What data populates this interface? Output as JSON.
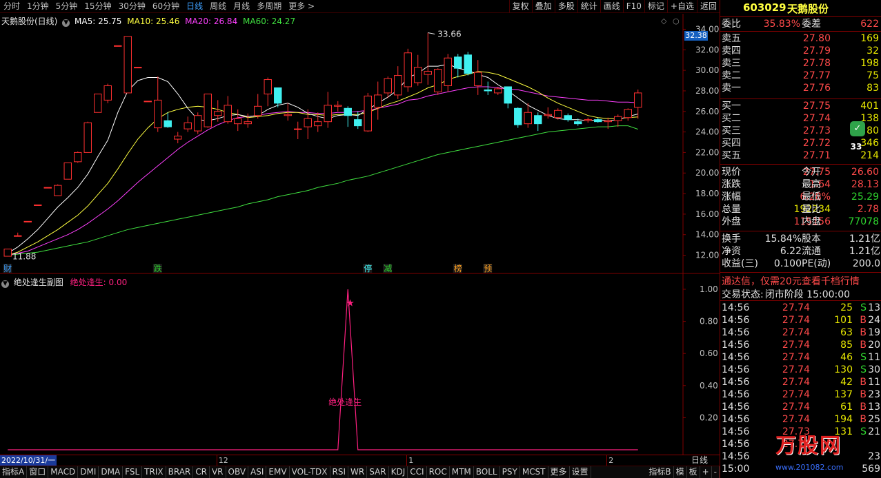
{
  "toolbar": {
    "periods": [
      "分时",
      "1分钟",
      "5分钟",
      "15分钟",
      "30分钟",
      "60分钟",
      "日线",
      "周线",
      "月线",
      "多周期",
      "更多 >"
    ],
    "active_period": "日线",
    "buttons": [
      "复权",
      "叠加",
      "多股",
      "统计",
      "画线",
      "F10",
      "标记",
      "+自选",
      "返回"
    ]
  },
  "main_legend": {
    "title": "天鹅股份(日线)",
    "ma5": "MA5: 25.75",
    "ma10": "MA10: 25.46",
    "ma20": "MA20: 26.84",
    "ma60": "MA60: 24.27"
  },
  "colors": {
    "up": "#ff3030",
    "down": "#40f0f0",
    "ma5": "#ffffff",
    "ma10": "#ffff40",
    "ma20": "#ff40ff",
    "ma60": "#40e040",
    "axis": "#800000",
    "sub": "#ff2080"
  },
  "y_axis": {
    "labels": [
      "34.00",
      "32.00",
      "30.00",
      "28.00",
      "26.00",
      "24.00",
      "22.00",
      "20.00",
      "18.00",
      "16.00",
      "14.00",
      "12.00"
    ],
    "current_price_tag": "32.38"
  },
  "annotations": {
    "high_label": "33.66",
    "low_label": "11.88",
    "markers": [
      {
        "text": "财",
        "color": "#3ea0ff"
      },
      {
        "text": "跌",
        "color": "#2fd62f"
      },
      {
        "text": "停",
        "color": "#40f0f0"
      },
      {
        "text": "减",
        "color": "#2fd62f"
      },
      {
        "text": "榜",
        "color": "#ffa020"
      },
      {
        "text": "预",
        "color": "#ffa020"
      }
    ]
  },
  "sub_chart": {
    "title": "绝处逢生副图",
    "indicator": "绝处逢生: 0.00",
    "y_labels": [
      "1.00",
      "0.80",
      "0.60",
      "0.40",
      "0.20"
    ],
    "peak_label": "绝处逢生"
  },
  "date_axis": {
    "start": "2022/10/31/一",
    "labels": [
      "12",
      "1",
      "2"
    ],
    "right_label": "日线"
  },
  "bottom_tabs": [
    "指标A",
    "窗口",
    "MACD",
    "DMI",
    "DMA",
    "FSL",
    "TRIX",
    "BRAR",
    "CR",
    "VR",
    "OBV",
    "ASI",
    "EMV",
    "VOL-TDX",
    "RSI",
    "WR",
    "SAR",
    "KDJ",
    "CCI",
    "ROC",
    "MTM",
    "BOLL",
    "PSY",
    "MCST",
    "更多",
    "设置"
  ],
  "bottom_right": [
    "指标B",
    "模",
    "板",
    "+",
    "-"
  ],
  "quote": {
    "code": "603029",
    "name": "天鹅股份",
    "weibi_label": "委比",
    "weibi": "35.83%",
    "weicha_label": "委差",
    "weicha": "622",
    "asks": [
      {
        "label": "卖五",
        "price": "27.80",
        "vol": "169"
      },
      {
        "label": "卖四",
        "price": "27.79",
        "vol": "32"
      },
      {
        "label": "卖三",
        "price": "27.78",
        "vol": "198"
      },
      {
        "label": "卖二",
        "price": "27.77",
        "vol": "75"
      },
      {
        "label": "卖一",
        "price": "27.76",
        "vol": "83"
      }
    ],
    "bids": [
      {
        "label": "买一",
        "price": "27.75",
        "vol": "401"
      },
      {
        "label": "买二",
        "price": "27.74",
        "vol": "138"
      },
      {
        "label": "买三",
        "price": "27.73",
        "vol": "80"
      },
      {
        "label": "买四",
        "price": "27.72",
        "vol": "346"
      },
      {
        "label": "买五",
        "price": "27.71",
        "vol": "214"
      }
    ],
    "stats": [
      {
        "l1": "现价",
        "v1": "27.75",
        "l2": "今开",
        "v2": "26.60"
      },
      {
        "l1": "涨跌",
        "v1": "1.64",
        "l2": "最高",
        "v2": "28.13"
      },
      {
        "l1": "涨幅",
        "v1": "6.28%",
        "l2": "最低",
        "v2": "25.29"
      },
      {
        "l1": "总量",
        "v1": "192234",
        "l2": "量比",
        "v2": "2.78"
      },
      {
        "l1": "外盘",
        "v1": "115156",
        "l2": "内盘",
        "v2": "77078"
      }
    ],
    "stats2": [
      {
        "l1": "换手",
        "v1": "15.84%",
        "l2": "股本",
        "v2": "1.21亿"
      },
      {
        "l1": "净资",
        "v1": "6.22",
        "l2": "流通",
        "v2": "1.21亿"
      },
      {
        "l1": "收益(三)",
        "v1": "0.100",
        "l2": "PE(动)",
        "v2": "200.0"
      }
    ],
    "ad": "通达信，仅需20元查看千档行情",
    "status_label": "交易状态:",
    "status": "闭市阶段 15:00:00",
    "ticks": [
      {
        "t": "14:56",
        "p": "27.74",
        "v": "25",
        "d": "S",
        "n": "13"
      },
      {
        "t": "14:56",
        "p": "27.74",
        "v": "101",
        "d": "B",
        "n": "24"
      },
      {
        "t": "14:56",
        "p": "27.74",
        "v": "63",
        "d": "B",
        "n": "19"
      },
      {
        "t": "14:56",
        "p": "27.74",
        "v": "85",
        "d": "B",
        "n": "20"
      },
      {
        "t": "14:56",
        "p": "27.74",
        "v": "46",
        "d": "S",
        "n": "11"
      },
      {
        "t": "14:56",
        "p": "27.74",
        "v": "130",
        "d": "S",
        "n": "30"
      },
      {
        "t": "14:56",
        "p": "27.74",
        "v": "42",
        "d": "B",
        "n": "11"
      },
      {
        "t": "14:56",
        "p": "27.74",
        "v": "137",
        "d": "B",
        "n": "23"
      },
      {
        "t": "14:56",
        "p": "27.74",
        "v": "61",
        "d": "B",
        "n": "13"
      },
      {
        "t": "14:56",
        "p": "27.74",
        "v": "194",
        "d": "B",
        "n": "25"
      },
      {
        "t": "14:56",
        "p": "27.73",
        "v": "131",
        "d": "S",
        "n": "21"
      },
      {
        "t": "14:56",
        "p": "27.74",
        "v": "",
        "d": "",
        "n": ""
      },
      {
        "t": "14:56",
        "p": "",
        "v": "",
        "d": "",
        "n": "23"
      },
      {
        "t": "15:00",
        "p": "",
        "v": "",
        "d": "",
        "n": "569"
      }
    ],
    "side_badge": "33",
    "watermark": "万股网",
    "watermark_url": "www.201082.com"
  },
  "chart_data": {
    "type": "candlestick",
    "ylim": [
      11.5,
      34.5
    ],
    "candles": [
      {
        "o": 11.9,
        "c": 12.6,
        "h": 12.6,
        "l": 11.88
      },
      {
        "o": 13.9,
        "c": 13.9,
        "h": 14.2,
        "l": 13.9
      },
      {
        "o": 15.3,
        "c": 15.3,
        "h": 15.3,
        "l": 15.3
      },
      {
        "o": 16.9,
        "c": 16.9,
        "h": 16.9,
        "l": 16.9
      },
      {
        "o": 18.6,
        "c": 18.6,
        "h": 18.6,
        "l": 18.6
      },
      {
        "o": 17.8,
        "c": 18.8,
        "h": 18.9,
        "l": 17.8
      },
      {
        "o": 19.4,
        "c": 21.0,
        "h": 21.0,
        "l": 19.4
      },
      {
        "o": 21.1,
        "c": 22.0,
        "h": 22.1,
        "l": 21.0
      },
      {
        "o": 22.0,
        "c": 24.9,
        "h": 25.0,
        "l": 22.0
      },
      {
        "o": 25.9,
        "c": 27.7,
        "h": 27.7,
        "l": 25.9
      },
      {
        "o": 27.1,
        "c": 28.5,
        "h": 28.7,
        "l": 26.8
      },
      {
        "o": 32.4,
        "c": 32.4,
        "h": 32.4,
        "l": 32.4
      },
      {
        "o": 27.8,
        "c": 33.3,
        "h": 33.3,
        "l": 27.8
      },
      {
        "o": 30.3,
        "c": 30.3,
        "h": 30.3,
        "l": 30.3
      },
      {
        "o": 27.0,
        "c": 27.0,
        "h": 27.0,
        "l": 27.0
      },
      {
        "o": 24.4,
        "c": 27.1,
        "h": 29.4,
        "l": 24.0
      },
      {
        "o": 25.1,
        "c": 24.5,
        "h": 25.9,
        "l": 24.4
      },
      {
        "o": 23.3,
        "c": 23.6,
        "h": 24.0,
        "l": 22.9
      },
      {
        "o": 24.3,
        "c": 24.9,
        "h": 25.5,
        "l": 24.0
      },
      {
        "o": 24.1,
        "c": 25.6,
        "h": 25.9,
        "l": 23.8
      },
      {
        "o": 24.5,
        "c": 27.7,
        "h": 27.7,
        "l": 24.4
      },
      {
        "o": 25.6,
        "c": 26.0,
        "h": 27.1,
        "l": 25.0
      },
      {
        "o": 25.0,
        "c": 26.6,
        "h": 27.5,
        "l": 24.8
      },
      {
        "o": 24.8,
        "c": 25.3,
        "h": 26.2,
        "l": 24.1
      },
      {
        "o": 24.8,
        "c": 25.0,
        "h": 25.8,
        "l": 24.4
      },
      {
        "o": 25.6,
        "c": 26.5,
        "h": 27.7,
        "l": 25.3
      },
      {
        "o": 27.7,
        "c": 29.1,
        "h": 29.3,
        "l": 26.5
      },
      {
        "o": 28.3,
        "c": 26.8,
        "h": 28.3,
        "l": 26.4
      },
      {
        "o": 25.6,
        "c": 25.7,
        "h": 26.8,
        "l": 25.1
      },
      {
        "o": 24.3,
        "c": 24.3,
        "h": 25.0,
        "l": 23.3
      },
      {
        "o": 24.5,
        "c": 25.3,
        "h": 26.2,
        "l": 23.3
      },
      {
        "o": 24.6,
        "c": 25.0,
        "h": 25.9,
        "l": 24.0
      },
      {
        "o": 25.0,
        "c": 26.6,
        "h": 27.9,
        "l": 24.4
      },
      {
        "o": 26.5,
        "c": 26.6,
        "h": 27.0,
        "l": 26.0
      },
      {
        "o": 26.3,
        "c": 25.6,
        "h": 26.5,
        "l": 24.5
      },
      {
        "o": 25.2,
        "c": 24.6,
        "h": 26.0,
        "l": 24.3
      },
      {
        "o": 24.1,
        "c": 27.5,
        "h": 27.8,
        "l": 24.0
      },
      {
        "o": 26.4,
        "c": 27.6,
        "h": 28.9,
        "l": 25.2
      },
      {
        "o": 27.8,
        "c": 29.2,
        "h": 29.4,
        "l": 27.3
      },
      {
        "o": 27.6,
        "c": 29.5,
        "h": 30.4,
        "l": 27.2
      },
      {
        "o": 28.4,
        "c": 31.7,
        "h": 32.1,
        "l": 27.9
      },
      {
        "o": 28.8,
        "c": 30.3,
        "h": 31.5,
        "l": 28.5
      },
      {
        "o": 29.6,
        "c": 29.9,
        "h": 33.66,
        "l": 28.6
      },
      {
        "o": 27.9,
        "c": 30.1,
        "h": 30.2,
        "l": 27.6
      },
      {
        "o": 28.5,
        "c": 31.2,
        "h": 31.6,
        "l": 27.9
      },
      {
        "o": 31.3,
        "c": 30.2,
        "h": 31.6,
        "l": 29.3
      },
      {
        "o": 31.5,
        "c": 29.7,
        "h": 31.8,
        "l": 29.5
      },
      {
        "o": 28.5,
        "c": 29.8,
        "h": 31.0,
        "l": 27.6
      },
      {
        "o": 28.1,
        "c": 28.0,
        "h": 28.9,
        "l": 27.6
      },
      {
        "o": 27.8,
        "c": 28.2,
        "h": 28.4,
        "l": 27.6
      },
      {
        "o": 28.4,
        "c": 26.8,
        "h": 28.4,
        "l": 26.3
      },
      {
        "o": 26.3,
        "c": 24.7,
        "h": 26.4,
        "l": 24.4
      },
      {
        "o": 24.8,
        "c": 25.9,
        "h": 26.8,
        "l": 24.4
      },
      {
        "o": 25.6,
        "c": 24.8,
        "h": 25.9,
        "l": 24.1
      },
      {
        "o": 25.6,
        "c": 25.7,
        "h": 26.4,
        "l": 25.3
      },
      {
        "o": 25.4,
        "c": 26.1,
        "h": 26.3,
        "l": 25.2
      },
      {
        "o": 25.6,
        "c": 25.2,
        "h": 25.8,
        "l": 25.0
      },
      {
        "o": 25.0,
        "c": 24.8,
        "h": 25.3,
        "l": 24.6
      },
      {
        "o": 25.1,
        "c": 25.2,
        "h": 25.4,
        "l": 24.9
      },
      {
        "o": 25.2,
        "c": 25.0,
        "h": 25.4,
        "l": 24.9
      },
      {
        "o": 25.0,
        "c": 25.1,
        "h": 25.4,
        "l": 24.3
      },
      {
        "o": 25.1,
        "c": 25.5,
        "h": 25.7,
        "l": 24.5
      },
      {
        "o": 25.4,
        "c": 26.2,
        "h": 26.3,
        "l": 25.1
      },
      {
        "o": 26.4,
        "c": 27.8,
        "h": 28.13,
        "l": 25.29
      }
    ],
    "ma5": [
      12.2,
      12.8,
      13.6,
      14.5,
      15.6,
      16.7,
      17.6,
      18.6,
      19.9,
      21.6,
      23.2,
      25.9,
      28.0,
      29.0,
      29.3,
      29.3,
      28.9,
      27.7,
      26.3,
      25.2,
      25.1,
      25.3,
      25.6,
      25.7,
      25.5,
      25.6,
      26.2,
      26.6,
      26.8,
      26.4,
      25.8,
      25.5,
      25.3,
      25.6,
      25.7,
      25.6,
      26.2,
      26.8,
      27.4,
      28.1,
      29.3,
      29.7,
      30.4,
      30.4,
      30.6,
      30.2,
      30.0,
      29.6,
      29.3,
      28.6,
      28.0,
      27.3,
      26.6,
      26.1,
      25.6,
      25.3,
      25.2,
      25.2,
      25.1,
      25.2,
      25.1,
      25.2,
      25.5,
      25.75
    ],
    "ma10": [
      12.0,
      12.3,
      12.8,
      13.3,
      13.9,
      14.5,
      15.2,
      15.9,
      16.8,
      17.9,
      19.0,
      20.4,
      21.9,
      23.3,
      24.4,
      25.3,
      25.9,
      26.2,
      26.4,
      26.5,
      26.4,
      26.2,
      25.9,
      25.7,
      25.4,
      25.5,
      25.6,
      25.8,
      25.9,
      25.9,
      25.7,
      25.7,
      25.6,
      25.7,
      25.7,
      25.7,
      25.9,
      26.3,
      26.7,
      27.0,
      27.4,
      27.8,
      28.3,
      28.6,
      29.1,
      29.4,
      29.6,
      29.9,
      29.8,
      29.6,
      29.2,
      28.8,
      28.4,
      27.9,
      27.3,
      26.8,
      26.4,
      26.0,
      25.6,
      25.4,
      25.3,
      25.3,
      25.4,
      25.46
    ],
    "ma20": [
      12.0,
      12.2,
      12.4,
      12.8,
      13.2,
      13.6,
      14.0,
      14.5,
      15.1,
      15.8,
      16.5,
      17.3,
      18.2,
      19.1,
      19.9,
      20.7,
      21.5,
      22.3,
      23.0,
      23.6,
      24.2,
      24.7,
      25.1,
      25.4,
      25.5,
      25.6,
      25.8,
      25.9,
      26.0,
      25.9,
      25.9,
      25.8,
      25.8,
      25.9,
      25.9,
      26.0,
      26.1,
      26.3,
      26.5,
      26.7,
      27.1,
      27.2,
      27.5,
      27.7,
      27.9,
      28.1,
      28.3,
      28.4,
      28.4,
      28.3,
      28.2,
      28.1,
      27.9,
      27.7,
      27.5,
      27.4,
      27.3,
      27.2,
      27.1,
      27.1,
      27.0,
      26.9,
      26.9,
      26.84
    ],
    "ma60": [
      12.0,
      12.1,
      12.2,
      12.3,
      12.5,
      12.7,
      12.9,
      13.1,
      13.3,
      13.6,
      13.9,
      14.2,
      14.5,
      14.7,
      14.9,
      15.1,
      15.3,
      15.5,
      15.7,
      15.9,
      16.1,
      16.3,
      16.5,
      16.7,
      17.0,
      17.2,
      17.4,
      17.7,
      17.9,
      18.1,
      18.3,
      18.6,
      18.8,
      19.0,
      19.3,
      19.5,
      19.7,
      20.0,
      20.3,
      20.6,
      20.9,
      21.2,
      21.5,
      21.8,
      22.0,
      22.2,
      22.4,
      22.6,
      22.8,
      23.0,
      23.2,
      23.4,
      23.6,
      23.8,
      24.0,
      24.1,
      24.2,
      24.3,
      24.4,
      24.5,
      24.5,
      24.6,
      24.6,
      24.27
    ],
    "sub_series": {
      "peak_index": 34,
      "peak_value": 1.0,
      "ylim": [
        0,
        1.0
      ]
    }
  }
}
